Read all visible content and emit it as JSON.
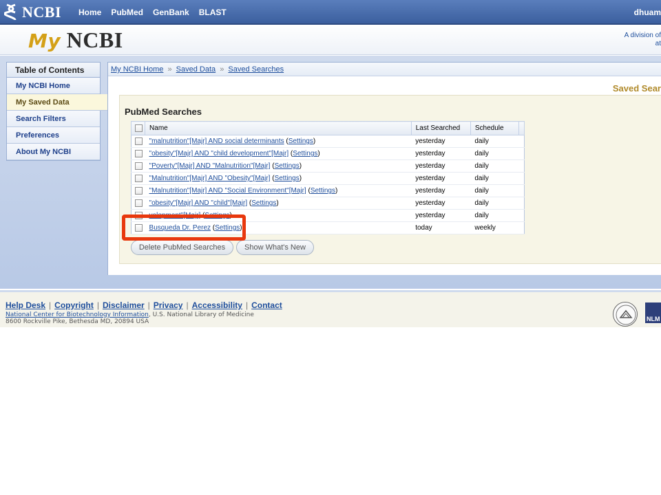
{
  "topbar": {
    "logo": "NCBI",
    "nav": [
      "Home",
      "PubMed",
      "GenBank",
      "BLAST"
    ],
    "user": "dhuam"
  },
  "header": {
    "title_my": "My",
    "title_ncbi": "NCBI",
    "division_line1": "A division of",
    "division_line2": "at"
  },
  "sidebar": {
    "title": "Table of Contents",
    "items": [
      {
        "label": "My NCBI Home",
        "active": false
      },
      {
        "label": "My Saved Data",
        "active": true
      },
      {
        "label": "Search Filters",
        "active": false
      },
      {
        "label": "Preferences",
        "active": false
      },
      {
        "label": "About My NCBI",
        "active": false
      }
    ]
  },
  "breadcrumb": [
    "My NCBI Home",
    "Saved Data",
    "Saved Searches"
  ],
  "breadcrumb_sep": "»",
  "page_title": "Saved Sear",
  "panel": {
    "title": "PubMed Searches",
    "columns": [
      "Name",
      "Last Searched",
      "Schedule"
    ],
    "settings_label": "Settings",
    "rows": [
      {
        "name": "\"malnutrition\"[Majr] AND social determinants",
        "last": "yesterday",
        "schedule": "daily"
      },
      {
        "name": "\"obesity\"[Majr] AND \"child development\"[Majr]",
        "last": "yesterday",
        "schedule": "daily"
      },
      {
        "name": "\"Poverty\"[Majr] AND \"Malnutrition\"[Majr]",
        "last": "yesterday",
        "schedule": "daily"
      },
      {
        "name": "\"Malnutrition\"[Majr] AND \"Obesity\"[Majr]",
        "last": "yesterday",
        "schedule": "daily"
      },
      {
        "name": "\"Malnutrition\"[Majr] AND \"Social Environment\"[Majr]",
        "last": "yesterday",
        "schedule": "daily"
      },
      {
        "name": "\"obesity\"[Majr] AND \"child\"[Majr]",
        "last": "yesterday",
        "schedule": "daily"
      },
      {
        "name": "velopment\"[Majr]",
        "last": "yesterday",
        "schedule": "daily"
      },
      {
        "name": "Busqueda Dr. Perez",
        "last": "today",
        "schedule": "weekly"
      }
    ],
    "delete_button": "Delete PubMed Searches",
    "whatsnew_button": "Show What's New"
  },
  "footer": {
    "links": [
      "Help Desk",
      "Copyright",
      "Disclaimer",
      "Privacy",
      "Accessibility",
      "Contact"
    ],
    "org_link": "National Center for Biotechnology Information",
    "org_rest": ", U.S. National Library of Medicine",
    "address": "8600 Rockville Pike, Bethesda MD, 20894 USA",
    "nlm": "NLM"
  },
  "colors": {
    "topbar": "#3b5f9e",
    "accent_gold": "#d4a017",
    "link": "#1e4e9c",
    "highlight": "#e8380d"
  }
}
